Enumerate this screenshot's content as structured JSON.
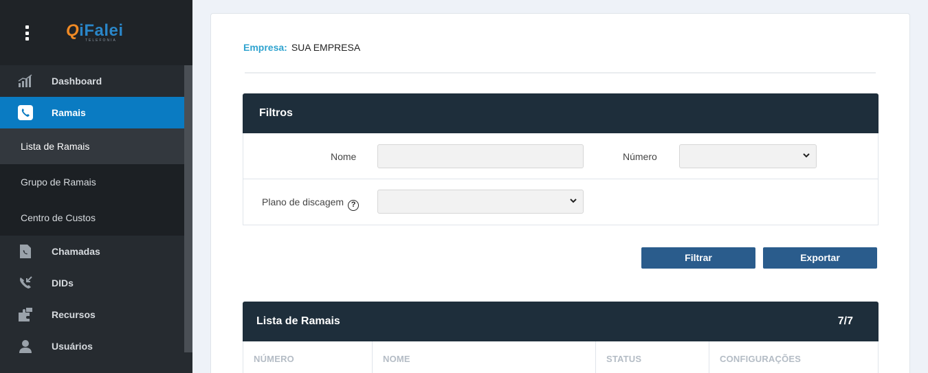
{
  "brand": {
    "logo_q": "Q",
    "logo_rest": "iFalei",
    "logo_sub": "TELEFONIA"
  },
  "menu": {
    "items": [
      {
        "label": "Dashboard",
        "icon": "bar-chart-icon"
      },
      {
        "label": "Ramais",
        "icon": "phone-icon"
      },
      {
        "label": "Chamadas",
        "icon": "phone-document-icon"
      },
      {
        "label": "DIDs",
        "icon": "incoming-call-icon"
      },
      {
        "label": "Recursos",
        "icon": "puzzle-icon"
      },
      {
        "label": "Usuários",
        "icon": "user-icon"
      }
    ],
    "subitems": [
      {
        "label": "Lista de Ramais"
      },
      {
        "label": "Grupo de Ramais"
      },
      {
        "label": "Centro de Custos"
      }
    ]
  },
  "company": {
    "label": "Empresa:",
    "value": "SUA EMPRESA"
  },
  "filters": {
    "title": "Filtros",
    "nome_label": "Nome",
    "nome_value": "",
    "numero_label": "Número",
    "plano_label": "Plano de discagem",
    "help_glyph": "?",
    "filtrar_label": "Filtrar",
    "exportar_label": "Exportar"
  },
  "list": {
    "title": "Lista de Ramais",
    "count": "7/7",
    "columns": [
      "NÚMERO",
      "NOME",
      "STATUS",
      "CONFIGURAÇÕES"
    ]
  }
}
